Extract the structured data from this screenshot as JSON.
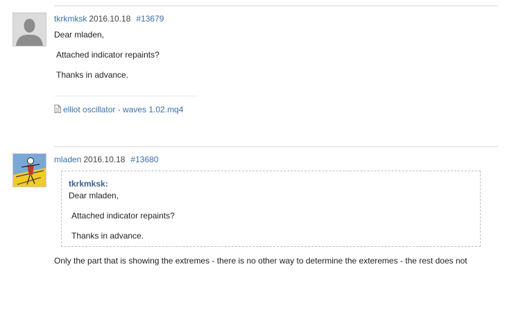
{
  "posts": [
    {
      "author": "tkrkmksk",
      "date": "2016.10.18",
      "post_number": "#13679",
      "avatar_icon": "default-user-avatar-icon",
      "body": [
        "Dear mladen,",
        "Attached indicator repaints?",
        "Thanks in advance."
      ],
      "attachment": {
        "icon": "file-icon",
        "name": "elliot oscillator - waves 1.02.mq4"
      }
    },
    {
      "author": "mladen",
      "date": "2016.10.18",
      "post_number": "#13680",
      "avatar_icon": "mladen-user-avatar-icon",
      "quote": {
        "author": "tkrkmksk:",
        "lines": [
          "Dear mladen,",
          "Attached indicator repaints?",
          "Thanks in advance."
        ]
      },
      "body": "Only the part that is showing the extremes - there is no other way to determine the exteremes - the rest does not"
    }
  ],
  "colors": {
    "link": "#3a6ea8",
    "quote_author": "#3b5e8a",
    "text": "#1e1e1e",
    "divider": "#d8d8d8",
    "quote_border": "#bdbdbd"
  }
}
